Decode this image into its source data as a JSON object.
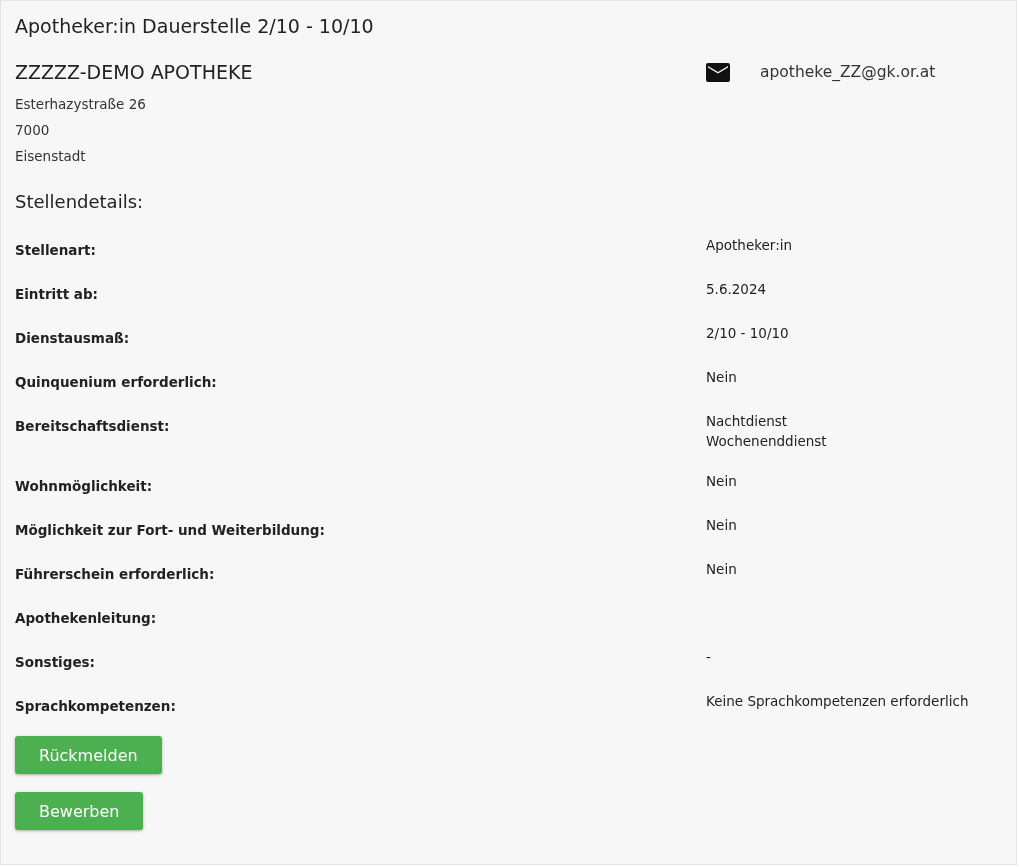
{
  "title": "Apotheker:in Dauerstelle 2/10 - 10/10",
  "company": {
    "name": "ZZZZZ-DEMO APOTHEKE",
    "address": [
      "Esterhazystraße 26",
      "7000",
      "Eisenstadt"
    ],
    "email": "apotheke_ZZ@gk.or.at"
  },
  "section_title": "Stellendetails:",
  "details": [
    {
      "label": "Stellenart:",
      "values": [
        "Apotheker:in"
      ]
    },
    {
      "label": "Eintritt ab:",
      "values": [
        "5.6.2024"
      ]
    },
    {
      "label": "Dienstausmaß:",
      "values": [
        "2/10 - 10/10"
      ]
    },
    {
      "label": "Quinquenium erforderlich:",
      "values": [
        "Nein"
      ]
    },
    {
      "label": "Bereitschaftsdienst:",
      "values": [
        "Nachtdienst",
        "Wochenenddienst"
      ]
    },
    {
      "label": "Wohnmöglichkeit:",
      "values": [
        "Nein"
      ]
    },
    {
      "label": "Möglichkeit zur Fort- und Weiterbildung:",
      "values": [
        "Nein"
      ]
    },
    {
      "label": "Führerschein erforderlich:",
      "values": [
        "Nein"
      ]
    },
    {
      "label": "Apothekenleitung:"
    },
    {
      "label": "Sonstiges:",
      "values": [
        "-"
      ]
    },
    {
      "label": "Sprachkompetenzen:",
      "values": [
        "Keine Sprachkompetenzen erforderlich"
      ]
    }
  ],
  "buttons": [
    "Rückmelden",
    "Bewerben"
  ]
}
